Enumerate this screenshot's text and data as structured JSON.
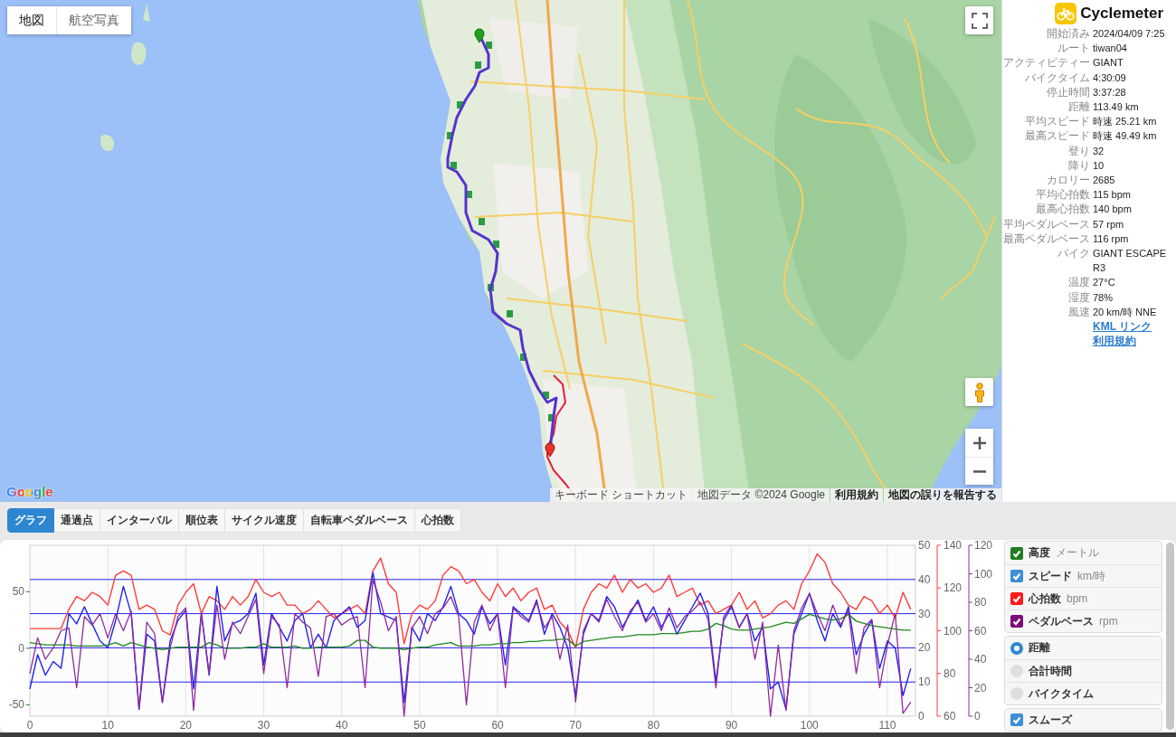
{
  "map": {
    "type_buttons": [
      {
        "label": "地図",
        "selected": true
      },
      {
        "label": "航空写真",
        "selected": false
      }
    ],
    "logo": "Google",
    "attribution": [
      {
        "text": "キーボード ショートカット",
        "kind": "button"
      },
      {
        "text": "地図データ ©2024 Google",
        "kind": "text"
      },
      {
        "text": "利用規約",
        "kind": "link"
      },
      {
        "text": "地図の誤りを報告する",
        "kind": "link"
      }
    ]
  },
  "summary": {
    "app_name": "Cyclemeter",
    "stats": [
      {
        "label": "開始済み",
        "value": "2024/04/09 7:25"
      },
      {
        "label": "ルート",
        "value": "tiwan04"
      },
      {
        "label": "アクティビティー",
        "value": "GIANT"
      },
      {
        "label": "バイクタイム",
        "value": "4:30:09"
      },
      {
        "label": "停止時間",
        "value": "3:37:28"
      },
      {
        "label": "距離",
        "value": "113.49 km"
      },
      {
        "label": "平均スピード",
        "value": "時速 25.21 km"
      },
      {
        "label": "最高スピード",
        "value": "時速 49.49 km"
      },
      {
        "label": "登り",
        "value": "32"
      },
      {
        "label": "降り",
        "value": "10"
      },
      {
        "label": "カロリー",
        "value": "2685"
      },
      {
        "label": "平均心拍数",
        "value": "115 bpm"
      },
      {
        "label": "最高心拍数",
        "value": "140 bpm"
      },
      {
        "label": "平均ペダルベース",
        "value": "57 rpm"
      },
      {
        "label": "最高ペダルベース",
        "value": "116 rpm"
      },
      {
        "label": "バイク",
        "value": "GIANT ESCAPE R3"
      },
      {
        "label": "温度",
        "value": "27°C"
      },
      {
        "label": "湿度",
        "value": "78%"
      },
      {
        "label": "風速",
        "value": "20 km/時 NNE"
      }
    ],
    "links": [
      "KML リンク",
      "利用規約"
    ]
  },
  "tabs": [
    {
      "label": "グラフ",
      "selected": true
    },
    {
      "label": "通過点",
      "selected": false
    },
    {
      "label": "インターバル",
      "selected": false
    },
    {
      "label": "順位表",
      "selected": false
    },
    {
      "label": "サイクル速度",
      "selected": false
    },
    {
      "label": "自転車ペダルベース",
      "selected": false
    },
    {
      "label": "心拍数",
      "selected": false
    }
  ],
  "graph": {
    "chart_layers": [
      {
        "chart_data": {
          "type": "line",
          "grid": true,
          "x": [
            0,
            1,
            2,
            3,
            4,
            5,
            6,
            7,
            8,
            9,
            10,
            11,
            12,
            13,
            14,
            15,
            16,
            17,
            18,
            19,
            20,
            21,
            22,
            23,
            24,
            25,
            26,
            27,
            28,
            29,
            30,
            31,
            32,
            33,
            34,
            35,
            36,
            37,
            38,
            39,
            40,
            41,
            42,
            43,
            44,
            45,
            46,
            47,
            48,
            49,
            50,
            51,
            52,
            53,
            54,
            55,
            56,
            57,
            58,
            59,
            60,
            61,
            62,
            63,
            64,
            65,
            66,
            67,
            68,
            69,
            70,
            71,
            72,
            73,
            74,
            75,
            76,
            77,
            78,
            79,
            80,
            81,
            82,
            83,
            84,
            85,
            86,
            87,
            88,
            89,
            90,
            91,
            92,
            93,
            94,
            95,
            96,
            97,
            98,
            99,
            100,
            101,
            102,
            103,
            104,
            105,
            106,
            107,
            108,
            109,
            110,
            111,
            112,
            113
          ],
          "xlim": [
            0,
            113.6
          ],
          "xticks": [
            0,
            10,
            20,
            30,
            40,
            50,
            60,
            70,
            80,
            90,
            100,
            110
          ],
          "ylim": [
            -60,
            91
          ],
          "yticks": [
            -50,
            0,
            50
          ],
          "y2lim": [
            0,
            50
          ],
          "y2ticks": [
            0,
            10,
            20,
            30,
            40,
            50
          ],
          "y3lim": [
            60,
            140
          ],
          "y3ticks": [
            60,
            80,
            100,
            120,
            140
          ],
          "series": [
            {
              "name": "高度",
              "color": "#1f8a1f",
              "values": [
                5,
                4,
                3,
                3,
                3,
                3,
                2,
                2,
                2,
                2,
                3,
                5,
                2,
                5,
                3,
                1,
                0,
                -1,
                0,
                1,
                1,
                1,
                1,
                5,
                3,
                0,
                0,
                0,
                1,
                1,
                4,
                1,
                1,
                1,
                2,
                0,
                0,
                1,
                1,
                1,
                1,
                2,
                7,
                7,
                1,
                0,
                0,
                0,
                -1,
                0,
                1,
                1,
                3,
                4,
                5,
                2,
                2,
                2,
                3,
                3,
                4,
                4,
                5,
                5,
                6,
                6,
                7,
                7,
                8,
                8,
                2,
                6,
                7,
                8,
                9,
                10,
                10,
                11,
                12,
                12,
                12,
                13,
                13,
                13,
                14,
                15,
                15,
                17,
                22,
                20,
                17,
                16,
                16,
                17,
                18,
                19,
                21,
                23,
                22,
                26,
                30,
                28,
                26,
                25,
                26,
                30,
                24,
                22,
                20,
                19,
                18,
                17,
                16,
                16
              ]
            },
            {
              "name": "スピード",
              "color": "#2222ee",
              "axis": "y2",
              "values": [
                8,
                18,
                12,
                16,
                14,
                30,
                27,
                32,
                27,
                22,
                20,
                28,
                38,
                30,
                2,
                24,
                22,
                4,
                22,
                28,
                31,
                8,
                30,
                12,
                38,
                22,
                27,
                28,
                30,
                36,
                15,
                30,
                26,
                22,
                28,
                30,
                20,
                24,
                20,
                28,
                30,
                32,
                26,
                28,
                42,
                30,
                29,
                28,
                4,
                26,
                22,
                30,
                28,
                32,
                38,
                30,
                28,
                24,
                32,
                27,
                30,
                15,
                32,
                30,
                28,
                34,
                24,
                30,
                26,
                20,
                6,
                24,
                30,
                28,
                35,
                32,
                26,
                30,
                34,
                28,
                32,
                26,
                30,
                24,
                28,
                32,
                36,
                30,
                10,
                28,
                32,
                26,
                30,
                22,
                26,
                8,
                10,
                2,
                24,
                30,
                36,
                28,
                22,
                30,
                26,
                32,
                18,
                24,
                28,
                14,
                22,
                20,
                6,
                14
              ]
            },
            {
              "name": "心拍数",
              "color": "#ff3b3b",
              "axis": "y3",
              "values": [
                101,
                101,
                101,
                101,
                101,
                110,
                116,
                114,
                118,
                116,
                112,
                126,
                128,
                126,
                110,
                112,
                110,
                100,
                98,
                112,
                118,
                122,
                108,
                116,
                114,
                110,
                116,
                112,
                116,
                124,
                118,
                116,
                118,
                112,
                112,
                108,
                110,
                114,
                110,
                106,
                108,
                110,
                112,
                108,
                128,
                134,
                122,
                118,
                94,
                108,
                112,
                110,
                114,
                126,
                130,
                128,
                122,
                124,
                118,
                114,
                122,
                116,
                120,
                114,
                118,
                120,
                110,
                112,
                104,
                100,
                92,
                110,
                118,
                122,
                120,
                126,
                118,
                124,
                120,
                122,
                118,
                120,
                126,
                116,
                118,
                120,
                112,
                114,
                108,
                110,
                112,
                118,
                110,
                114,
                106,
                108,
                112,
                114,
                110,
                122,
                128,
                136,
                132,
                122,
                118,
                112,
                110,
                116,
                114,
                108,
                112,
                106,
                118,
                110
              ]
            }
          ]
        }
      },
      {
        "chart_data": {
          "type": "line",
          "x": [
            0,
            1,
            2,
            3,
            4,
            5,
            6,
            7,
            8,
            9,
            10,
            11,
            12,
            13,
            14,
            15,
            16,
            17,
            18,
            19,
            20,
            21,
            22,
            23,
            24,
            25,
            26,
            27,
            28,
            29,
            30,
            31,
            32,
            33,
            34,
            35,
            36,
            37,
            38,
            39,
            40,
            41,
            42,
            43,
            44,
            45,
            46,
            47,
            48,
            49,
            50,
            51,
            52,
            53,
            54,
            55,
            56,
            57,
            58,
            59,
            60,
            61,
            62,
            63,
            64,
            65,
            66,
            67,
            68,
            69,
            70,
            71,
            72,
            73,
            74,
            75,
            76,
            77,
            78,
            79,
            80,
            81,
            82,
            83,
            84,
            85,
            86,
            87,
            88,
            89,
            90,
            91,
            92,
            93,
            94,
            95,
            96,
            97,
            98,
            99,
            100,
            101,
            102,
            103,
            104,
            105,
            106,
            107,
            108,
            109,
            110,
            111,
            112,
            113
          ],
          "xlim": [
            0,
            113.6
          ],
          "ylim": [
            0,
            120
          ],
          "yticks": [
            0,
            20,
            40,
            60,
            80,
            100,
            120
          ],
          "series": [
            {
              "name": "ペダルベース",
              "color": "#8e2a9e",
              "values": [
                30,
                55,
                40,
                48,
                60,
                62,
                20,
                70,
                64,
                72,
                55,
                72,
                60,
                74,
                5,
                66,
                58,
                10,
                48,
                70,
                76,
                4,
                72,
                30,
                78,
                40,
                66,
                58,
                70,
                82,
                30,
                70,
                64,
                20,
                72,
                66,
                62,
                28,
                70,
                72,
                64,
                68,
                70,
                20,
                96,
                80,
                60,
                70,
                0,
                62,
                70,
                58,
                72,
                76,
                84,
                70,
                8,
                66,
                78,
                60,
                72,
                20,
                76,
                70,
                66,
                80,
                62,
                70,
                40,
                64,
                10,
                60,
                72,
                66,
                82,
                70,
                60,
                74,
                80,
                66,
                72,
                60,
                76,
                62,
                70,
                74,
                80,
                68,
                20,
                70,
                78,
                62,
                72,
                40,
                66,
                0,
                50,
                4,
                60,
                76,
                86,
                72,
                60,
                78,
                64,
                74,
                30,
                62,
                68,
                20,
                50,
                72,
                2,
                10
              ]
            }
          ]
        }
      }
    ],
    "series_toggles": [
      {
        "unit": "メートル",
        "checked": true,
        "color": "#1f7d1f"
      },
      {
        "unit": "km/時",
        "checked": true,
        "color": "#3d8fd6"
      },
      {
        "unit": "bpm",
        "checked": true,
        "color": "#ff1a1a"
      },
      {
        "unit": "rpm",
        "checked": true,
        "color": "#7d0c7d"
      }
    ],
    "x_axis_options": [
      {
        "label": "距離",
        "selected": true
      },
      {
        "label": "合計時間",
        "selected": false
      },
      {
        "label": "バイクタイム",
        "selected": false
      }
    ],
    "options": [
      {
        "label": "スムーズ",
        "checked": true
      }
    ]
  }
}
